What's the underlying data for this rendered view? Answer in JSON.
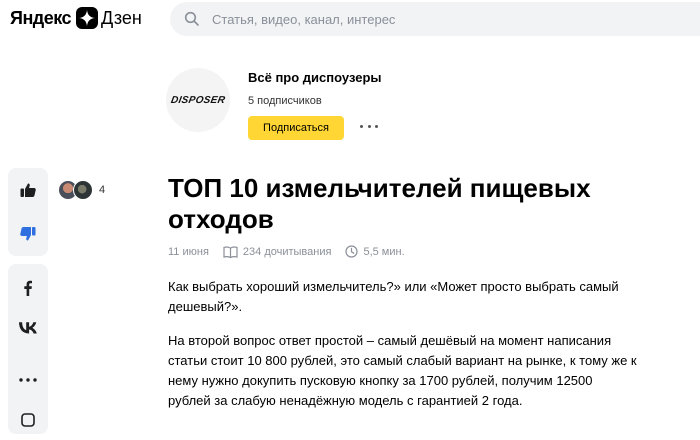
{
  "header": {
    "logo_yandex": "Яндекс",
    "logo_dzen": "Дзен",
    "search_placeholder": "Статья, видео, канал, интерес"
  },
  "channel": {
    "avatar_text": "DISPOSER",
    "name": "Всё про диспоузеры",
    "subscribers": "5 подписчиков",
    "subscribe_label": "Подписаться"
  },
  "reactions": {
    "count": "4"
  },
  "article": {
    "title": "ТОП 10 измельчителей пищевых отходов",
    "date": "11 июня",
    "reads": "234 дочитывания",
    "read_time": "5,5 мин.",
    "paragraphs": [
      "Как выбрать хороший измельчитель?» или «Может просто выбрать самый дешевый?».",
      "На второй вопрос ответ простой – самый дешёвый на момент написания статьи стоит 10 800 рублей, это самый слабый вариант на рынке, к тому же к нему нужно докупить пусковую кнопку за 1700 рублей, получим 12500 рублей за слабую ненадёжную модель с гарантией 2 года."
    ]
  },
  "colors": {
    "accent_yellow": "#ffd633",
    "dislike_blue": "#2f6fe0",
    "panel_gray": "#f2f3f5"
  }
}
